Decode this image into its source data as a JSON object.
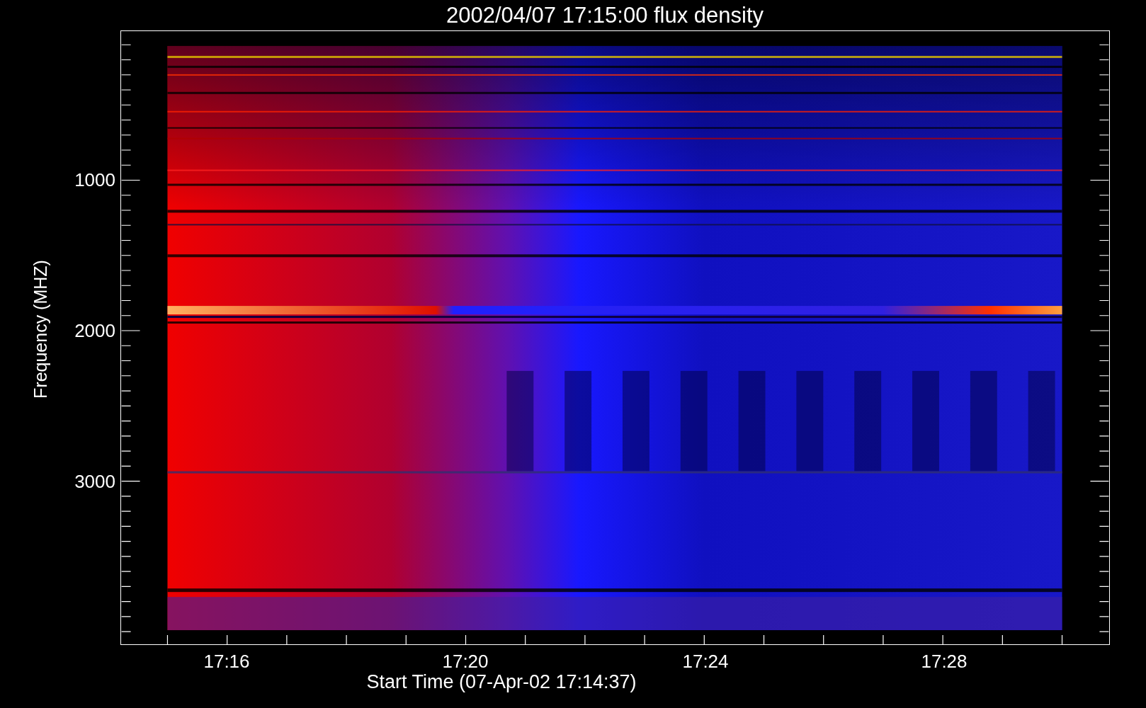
{
  "title": "2002/04/07 17:15:00 flux density",
  "y_axis": {
    "label": "Frequency (MHZ)",
    "ticks": [
      "1000",
      "2000",
      "3000"
    ]
  },
  "x_axis": {
    "label": "Start Time (07-Apr-02 17:14:37)",
    "ticks": [
      "17:16",
      "17:20",
      "17:24",
      "17:28"
    ]
  }
}
